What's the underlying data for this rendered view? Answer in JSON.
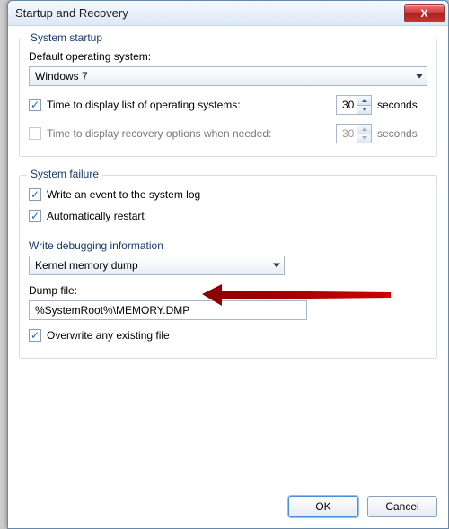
{
  "window": {
    "title": "Startup and Recovery"
  },
  "startup": {
    "legend": "System startup",
    "default_os_label": "Default operating system:",
    "default_os_value": "Windows 7",
    "display_os_list": {
      "checked": true,
      "label": "Time to display list of operating systems:",
      "value": "30",
      "unit": "seconds"
    },
    "display_recovery": {
      "checked": false,
      "enabled": false,
      "label": "Time to display recovery options when needed:",
      "value": "30",
      "unit": "seconds"
    }
  },
  "failure": {
    "legend": "System failure",
    "write_event": {
      "checked": true,
      "label": "Write an event to the system log"
    },
    "auto_restart": {
      "checked": true,
      "label": "Automatically restart"
    },
    "debug_legend": "Write debugging information",
    "dump_type": "Kernel memory dump",
    "dump_file_label": "Dump file:",
    "dump_file_value": "%SystemRoot%\\MEMORY.DMP",
    "overwrite": {
      "checked": true,
      "label": "Overwrite any existing file"
    }
  },
  "buttons": {
    "ok": "OK",
    "cancel": "Cancel"
  }
}
